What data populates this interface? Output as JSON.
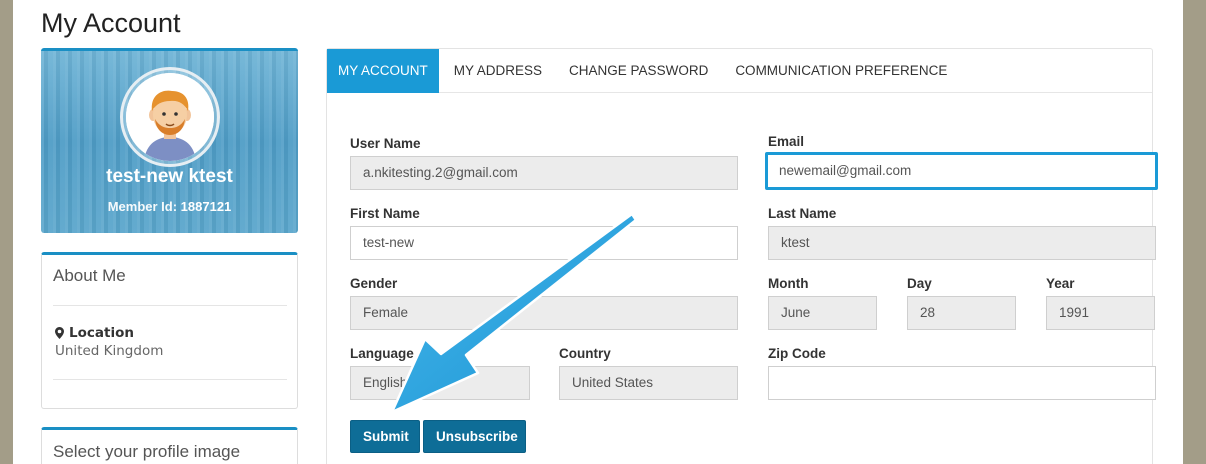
{
  "page": {
    "title": "My Account"
  },
  "profile": {
    "name": "test-new ktest",
    "member_id_label": "Member Id:",
    "member_id": "1887121"
  },
  "about": {
    "title": "About Me",
    "location_label": "Location",
    "location_value": "United Kingdom"
  },
  "select_image": {
    "title": "Select your profile image"
  },
  "tabs": [
    {
      "label": "MY ACCOUNT",
      "active": true
    },
    {
      "label": "MY ADDRESS"
    },
    {
      "label": "CHANGE PASSWORD"
    },
    {
      "label": "COMMUNICATION PREFERENCE"
    }
  ],
  "form": {
    "username": {
      "label": "User Name",
      "value": "a.nkitesting.2@gmail.com"
    },
    "email": {
      "label": "Email",
      "value": "newemail@gmail.com"
    },
    "first_name": {
      "label": "First Name",
      "value": "test-new"
    },
    "last_name": {
      "label": "Last Name",
      "value": "ktest"
    },
    "gender": {
      "label": "Gender",
      "value": "Female"
    },
    "month": {
      "label": "Month",
      "value": "June"
    },
    "day": {
      "label": "Day",
      "value": "28"
    },
    "year": {
      "label": "Year",
      "value": "1991"
    },
    "language": {
      "label": "Language",
      "value": "English"
    },
    "country": {
      "label": "Country",
      "value": "United States"
    },
    "zip": {
      "label": "Zip Code",
      "value": ""
    }
  },
  "buttons": {
    "submit": "Submit",
    "unsubscribe": "Unsubscribe"
  },
  "colors": {
    "accent": "#1a9ad6",
    "button": "#0e6d97",
    "background": "#a39d88"
  }
}
